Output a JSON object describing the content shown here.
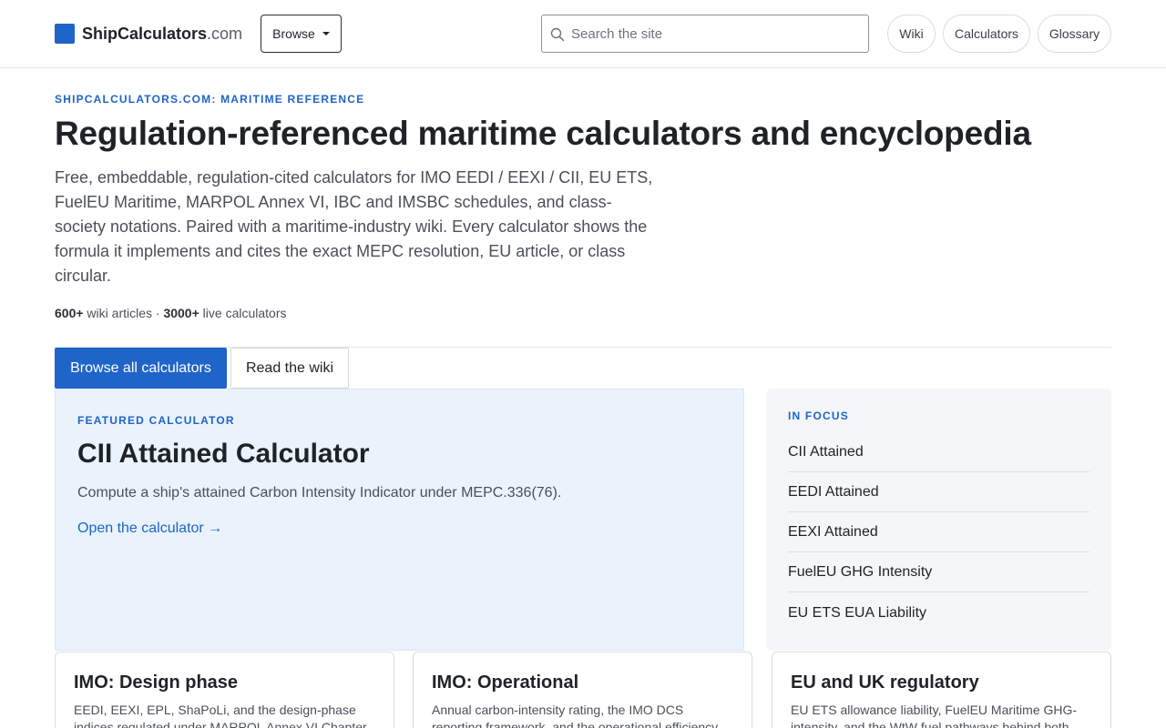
{
  "header": {
    "logo_name": "ShipCalculators",
    "logo_tld": ".com",
    "browse_label": "Browse",
    "search_placeholder": "Search the site",
    "nav": [
      {
        "label": "Wiki"
      },
      {
        "label": "Calculators"
      },
      {
        "label": "Glossary"
      }
    ]
  },
  "hero": {
    "eyebrow": "SHIPCALCULATORS.COM: MARITIME REFERENCE",
    "title": "Regulation-referenced maritime calculators and encyclopedia",
    "description": "Free, embeddable, regulation-cited calculators for IMO EEDI / EEXI / CII, EU ETS, FuelEU Maritime, MARPOL Annex VI, IBC and IMSBC schedules, and class-society notations. Paired with a maritime-industry wiki. Every calculator shows the formula it implements and cites the exact MEPC resolution, EU article, or class circular.",
    "stat_wiki_count": "600+",
    "stat_wiki_label": " wiki articles · ",
    "stat_calc_count": "3000+",
    "stat_calc_label": " live calculators",
    "cta_primary": "Browse all calculators",
    "cta_secondary": "Read the wiki"
  },
  "featured": {
    "eyebrow": "FEATURED CALCULATOR",
    "title": "CII Attained Calculator",
    "description": "Compute a ship's attained Carbon Intensity Indicator under MEPC.336(76).",
    "link": "Open the calculator →"
  },
  "focus": {
    "eyebrow": "IN FOCUS",
    "items": [
      {
        "label": "CII Attained"
      },
      {
        "label": "EEDI Attained"
      },
      {
        "label": "EEXI Attained"
      },
      {
        "label": "FuelEU GHG Intensity"
      },
      {
        "label": "EU ETS EUA Liability"
      }
    ]
  },
  "categories": [
    {
      "title": "IMO: Design phase",
      "description": "EEDI, EEXI, EPL, ShaPoLi, and the design-phase indices regulated under MARPOL Annex VI Chapter"
    },
    {
      "title": "IMO: Operational",
      "description": "Annual carbon-intensity rating, the IMO DCS reporting framework, and the operational efficiency"
    },
    {
      "title": "EU and UK regulatory",
      "description": "EU ETS allowance liability, FuelEU Maritime GHG-intensity, and the WtW fuel pathways behind both"
    }
  ],
  "colors": {
    "accent": "#1f64c8",
    "featured_bg": "#eaf2fc",
    "focus_bg": "#f4f6f8"
  }
}
